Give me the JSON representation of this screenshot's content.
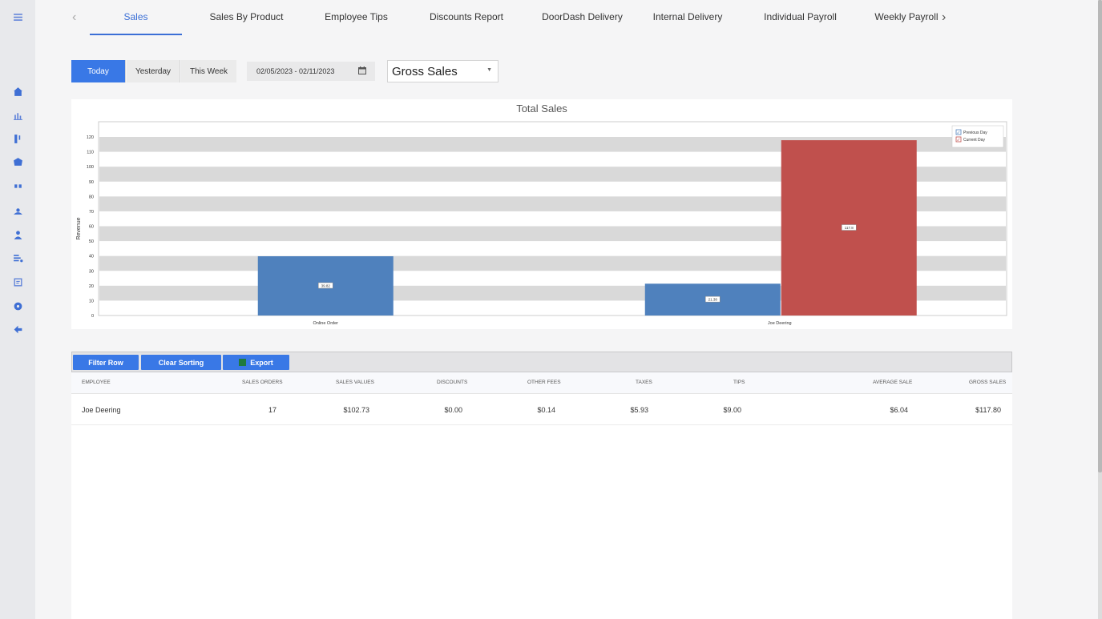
{
  "tabs": [
    {
      "label": "Sales"
    },
    {
      "label": "Sales By Product"
    },
    {
      "label": "Employee Tips"
    },
    {
      "label": "Discounts Report"
    },
    {
      "label": "DoorDash Delivery"
    },
    {
      "label": "Internal Delivery"
    },
    {
      "label": "Individual Payroll"
    },
    {
      "label": "Weekly Payroll"
    }
  ],
  "nav_arrows": {
    "prev": "‹",
    "next": "›"
  },
  "filters": {
    "today": "Today",
    "yesterday": "Yesterday",
    "this_week": "This Week",
    "date_range": "02/05/2023 - 02/11/2023",
    "metric": "Gross Sales"
  },
  "sidebar": {
    "icons": [
      "menu-icon",
      "home-icon",
      "bar-chart-icon",
      "flag-icon",
      "hexagon-icon",
      "grid-icon",
      "users-icon",
      "user-icon",
      "list-icon",
      "document-icon",
      "settings-icon",
      "back-arrow-icon"
    ]
  },
  "colors": {
    "accent": "#3978e6",
    "previous_day": "#4f81bd",
    "current_day": "#c0504d"
  },
  "chart_data": {
    "type": "bar",
    "title": "Total Sales",
    "ylabel": "Revenue",
    "xlabel": "",
    "ylim": [
      0,
      120
    ],
    "yticks": [
      0,
      10,
      20,
      30,
      40,
      50,
      60,
      70,
      80,
      90,
      100,
      110,
      120
    ],
    "categories": [
      "Online Order",
      "Joe Deering"
    ],
    "series": [
      {
        "name": "Previous Day",
        "values": [
          39.82,
          21.38
        ],
        "labels": [
          "39.82",
          "21.38"
        ],
        "color": "#4f81bd"
      },
      {
        "name": "Current Day",
        "values": [
          null,
          117.8
        ],
        "labels": [
          null,
          "117.8"
        ],
        "color": "#c0504d"
      }
    ],
    "grid": true,
    "legend_position": "top-right"
  },
  "grid": {
    "buttons": {
      "filter_row": "Filter Row",
      "clear_sorting": "Clear Sorting",
      "export": "Export"
    },
    "columns": [
      "Employee",
      "Sales Orders",
      "Sales Values",
      "Discounts",
      "Other Fees",
      "Taxes",
      "Tips",
      "Average Sale",
      "Gross Sales"
    ],
    "rows": [
      [
        "Joe Deering",
        "17",
        "$102.73",
        "$0.00",
        "$0.14",
        "$5.93",
        "$9.00",
        "$6.04",
        "$117.80"
      ]
    ]
  }
}
